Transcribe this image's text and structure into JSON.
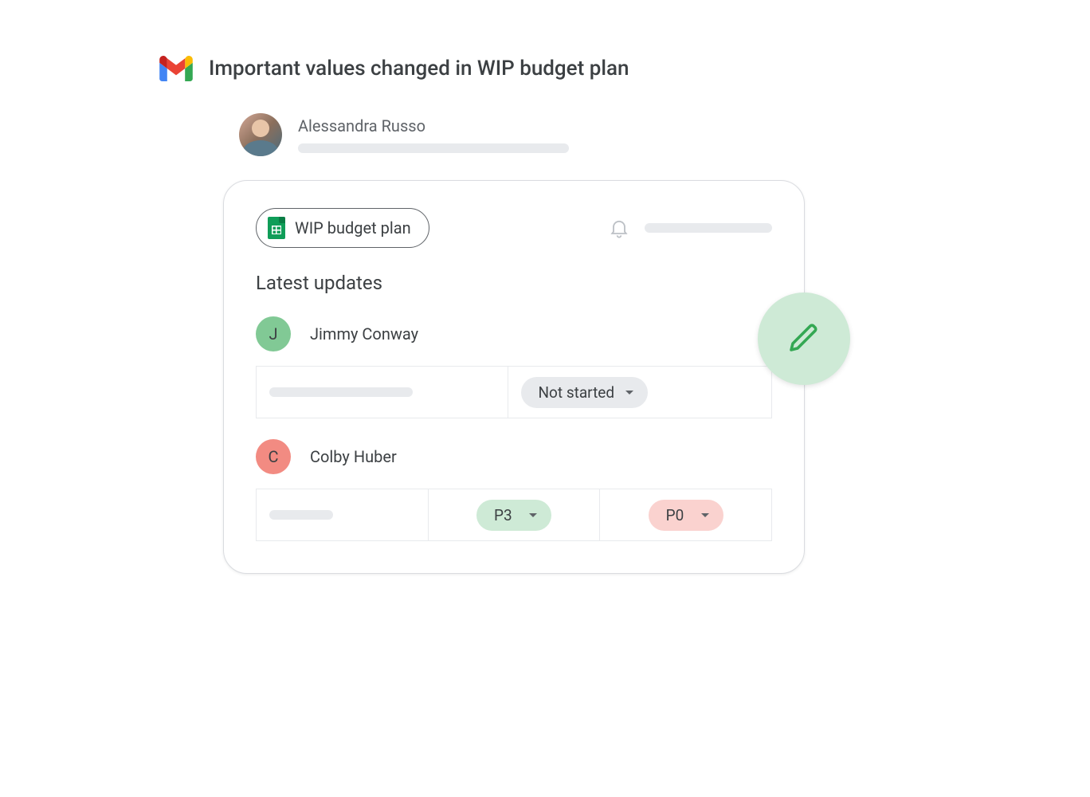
{
  "email": {
    "subject": "Important values changed in WIP budget plan",
    "sender_name": "Alessandra Russo"
  },
  "card": {
    "chip_label": "WIP budget plan",
    "section_title": "Latest updates"
  },
  "updates": [
    {
      "avatar_letter": "J",
      "avatar_color": "green",
      "name": "Jimmy Conway",
      "cells": [
        {
          "type": "placeholder"
        },
        {
          "type": "pill",
          "label": "Not started",
          "color": "grey"
        }
      ]
    },
    {
      "avatar_letter": "C",
      "avatar_color": "red",
      "name": "Colby Huber",
      "cells": [
        {
          "type": "placeholder_small"
        },
        {
          "type": "pill",
          "label": "P3",
          "color": "green"
        },
        {
          "type": "pill",
          "label": "P0",
          "color": "red"
        }
      ]
    }
  ]
}
